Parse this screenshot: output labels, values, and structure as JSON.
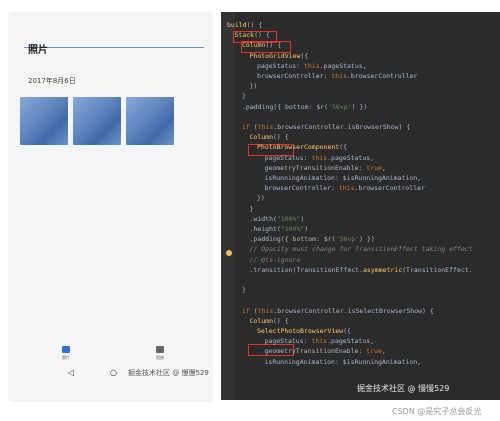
{
  "phone": {
    "title": "照片",
    "date": "2017年8月6日",
    "tabs": [
      {
        "label": "图片"
      },
      {
        "label": "相册"
      }
    ],
    "nav": {
      "back": "◁",
      "home": "○"
    },
    "watermark": "掘金技术社区 @ 慢慢529"
  },
  "code_lines": [
    {
      "key": "l01",
      "indent": 0,
      "parts": [
        [
          "fn",
          "build"
        ],
        [
          "",
          "() {"
        ]
      ]
    },
    {
      "key": "l02",
      "indent": 1,
      "parts": [
        [
          "fn",
          "Stack"
        ],
        [
          "",
          "() {"
        ]
      ]
    },
    {
      "key": "l03",
      "indent": 2,
      "parts": [
        [
          "fn",
          "Column"
        ],
        [
          "",
          "() {"
        ]
      ]
    },
    {
      "key": "l04",
      "indent": 3,
      "parts": [
        [
          "fn",
          "PhotoGridView"
        ],
        [
          "",
          "({"
        ]
      ]
    },
    {
      "key": "l05",
      "indent": 4,
      "parts": [
        [
          "",
          "pageStatus: "
        ],
        [
          "kw",
          "this"
        ],
        [
          "",
          ".pageStatus,"
        ]
      ]
    },
    {
      "key": "l06",
      "indent": 4,
      "parts": [
        [
          "",
          "browserController: "
        ],
        [
          "kw",
          "this"
        ],
        [
          "",
          ".browserController"
        ]
      ]
    },
    {
      "key": "l07",
      "indent": 3,
      "parts": [
        [
          "",
          "})"
        ]
      ]
    },
    {
      "key": "l08",
      "indent": 2,
      "parts": [
        [
          "",
          "}"
        ]
      ]
    },
    {
      "key": "l09",
      "indent": 2,
      "parts": [
        [
          "",
          ".padding({ bottom: $r("
        ],
        [
          "str",
          "'56vp'"
        ],
        [
          "",
          ") })"
        ]
      ]
    },
    {
      "key": "l10",
      "indent": 0,
      "parts": [
        [
          "",
          ""
        ]
      ]
    },
    {
      "key": "l11",
      "indent": 2,
      "parts": [
        [
          "kw",
          "if"
        ],
        [
          "",
          " ("
        ],
        [
          "kw",
          "this"
        ],
        [
          "",
          ".browserController.isBrowserShow) {"
        ]
      ]
    },
    {
      "key": "l12",
      "indent": 3,
      "parts": [
        [
          "fn",
          "Column"
        ],
        [
          "",
          "() {"
        ]
      ]
    },
    {
      "key": "l13",
      "indent": 4,
      "parts": [
        [
          "fn",
          "PhotoBrowserComponent"
        ],
        [
          "",
          "({"
        ]
      ]
    },
    {
      "key": "l14",
      "indent": 5,
      "parts": [
        [
          "",
          "pageStatus: "
        ],
        [
          "kw",
          "this"
        ],
        [
          "",
          ".pageStatus,"
        ]
      ]
    },
    {
      "key": "l15",
      "indent": 5,
      "parts": [
        [
          "",
          "geometryTransitionEnable: "
        ],
        [
          "kw",
          "true"
        ],
        [
          "",
          ","
        ]
      ]
    },
    {
      "key": "l16",
      "indent": 5,
      "parts": [
        [
          "",
          "isRunningAnimation: $isRunningAnimation,"
        ]
      ]
    },
    {
      "key": "l17",
      "indent": 5,
      "parts": [
        [
          "",
          "browserController: "
        ],
        [
          "kw",
          "this"
        ],
        [
          "",
          ".browserController"
        ]
      ]
    },
    {
      "key": "l18",
      "indent": 4,
      "parts": [
        [
          "",
          "})"
        ]
      ]
    },
    {
      "key": "l19",
      "indent": 3,
      "parts": [
        [
          "",
          "}"
        ]
      ]
    },
    {
      "key": "l20",
      "indent": 3,
      "parts": [
        [
          "",
          ".width("
        ],
        [
          "str",
          "\"100%\""
        ],
        [
          "",
          ")"
        ]
      ]
    },
    {
      "key": "l21",
      "indent": 3,
      "parts": [
        [
          "",
          ".height("
        ],
        [
          "str",
          "\"100%\""
        ],
        [
          "",
          ")"
        ]
      ]
    },
    {
      "key": "l22",
      "indent": 3,
      "parts": [
        [
          "",
          ".padding({ bottom: $r("
        ],
        [
          "str",
          "'56vp'"
        ],
        [
          "",
          ") })"
        ]
      ]
    },
    {
      "key": "l23",
      "indent": 3,
      "parts": [
        [
          "cm",
          "// Opacity must change for TransitionEffect taking effect"
        ]
      ]
    },
    {
      "key": "l24",
      "indent": 3,
      "parts": [
        [
          "cm",
          "// @ts-ignore"
        ]
      ]
    },
    {
      "key": "l25",
      "indent": 3,
      "parts": [
        [
          "",
          ".transition(TransitionEffect."
        ],
        [
          "fn",
          "asymmetric"
        ],
        [
          "",
          "(TransitionEffect."
        ]
      ]
    },
    {
      "key": "l26",
      "indent": 0,
      "parts": [
        [
          "",
          ""
        ]
      ]
    },
    {
      "key": "l27",
      "indent": 2,
      "parts": [
        [
          "",
          "}"
        ]
      ]
    },
    {
      "key": "l28",
      "indent": 0,
      "parts": [
        [
          "",
          ""
        ]
      ]
    },
    {
      "key": "l29",
      "indent": 2,
      "parts": [
        [
          "kw",
          "if"
        ],
        [
          "",
          " ("
        ],
        [
          "kw",
          "this"
        ],
        [
          "",
          ".browserController.isSelectBrowserShow) {"
        ]
      ]
    },
    {
      "key": "l30",
      "indent": 3,
      "parts": [
        [
          "fn",
          "Column"
        ],
        [
          "",
          "() {"
        ]
      ]
    },
    {
      "key": "l31",
      "indent": 4,
      "parts": [
        [
          "fn",
          "SelectPhotoBrowserView"
        ],
        [
          "",
          "({"
        ]
      ]
    },
    {
      "key": "l32",
      "indent": 5,
      "parts": [
        [
          "",
          "pageStatus: "
        ],
        [
          "kw",
          "this"
        ],
        [
          "",
          ".pageStatus,"
        ]
      ]
    },
    {
      "key": "l33",
      "indent": 5,
      "parts": [
        [
          "",
          "geometryTransitionEnable: "
        ],
        [
          "kw",
          "true"
        ],
        [
          "",
          ","
        ]
      ]
    },
    {
      "key": "l34",
      "indent": 5,
      "parts": [
        [
          "",
          "isRunningAnimation: $isRunningAnimation,"
        ]
      ]
    }
  ],
  "code_watermark": "掘金技术社区 @ 慢慢529",
  "footer_watermark": "CSDN @是究子总会反光"
}
